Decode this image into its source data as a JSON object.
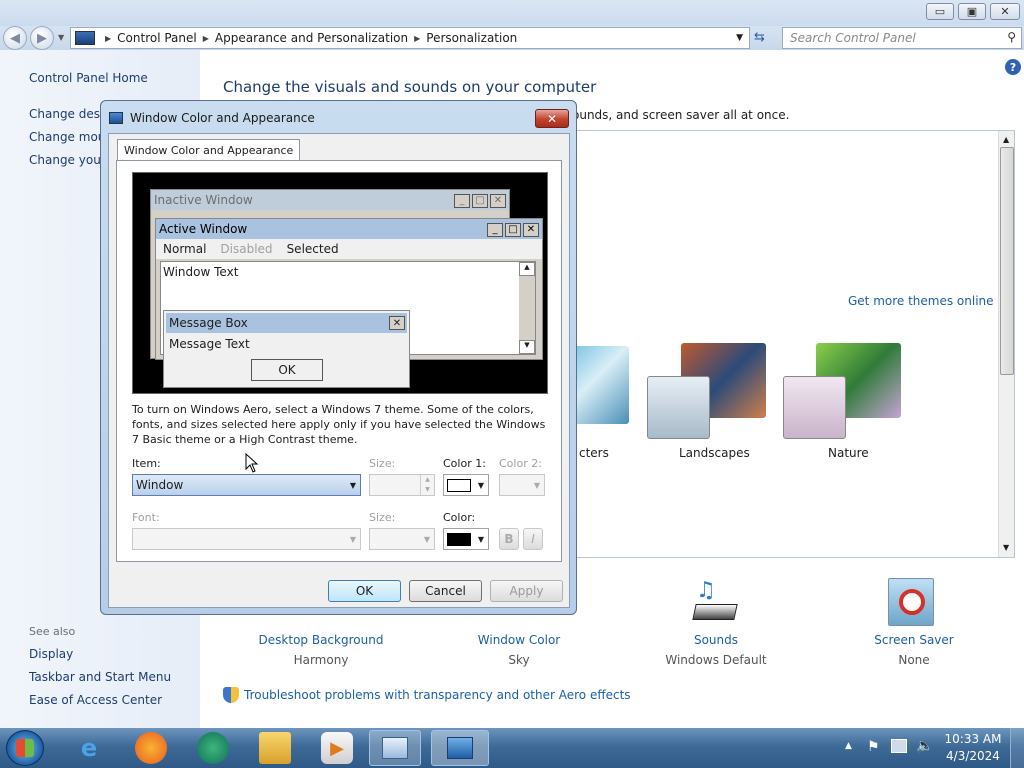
{
  "window": {
    "buttons": {
      "minimize": "▭",
      "maximize": "▣",
      "close": "✕"
    }
  },
  "address": {
    "crumbs": [
      "Control Panel",
      "Appearance and Personalization",
      "Personalization"
    ],
    "search_placeholder": "Search Control Panel"
  },
  "left_pane": {
    "home": "Control Panel Home",
    "links": [
      "Change desktop icons",
      "Change mouse pointers",
      "Change your account picture"
    ],
    "see_also_label": "See also",
    "see_also": [
      "Display",
      "Taskbar and Start Menu",
      "Ease of Access Center"
    ]
  },
  "main": {
    "title": "Change the visuals and sounds on your computer",
    "subtitle_tail": "ounds, and screen saver all at once.",
    "get_more": "Get more themes online",
    "themes": [
      "Characters",
      "Landscapes",
      "Nature"
    ],
    "themes_visible": [
      "cters",
      "Landscapes",
      "Nature"
    ],
    "bottom_items": [
      {
        "label": "Desktop Background",
        "value": "Harmony"
      },
      {
        "label": "Window Color",
        "value": "Sky"
      },
      {
        "label": "Sounds",
        "value": "Windows Default"
      },
      {
        "label": "Screen Saver",
        "value": "None"
      }
    ],
    "troubleshoot": "Troubleshoot problems with transparency and other Aero effects"
  },
  "dialog": {
    "title": "Window Color and Appearance",
    "tab": "Window Color and Appearance",
    "preview": {
      "inactive": "Inactive Window",
      "active": "Active Window",
      "menu": [
        "Normal",
        "Disabled",
        "Selected"
      ],
      "window_text": "Window Text",
      "msgbox_title": "Message Box",
      "msgbox_text": "Message Text",
      "msgbox_ok": "OK"
    },
    "info": "To turn on Windows Aero, select a Windows 7 theme.  Some of the colors, fonts, and sizes selected here apply only if you have selected the Windows 7 Basic theme or a High Contrast theme.",
    "item_label": "Item:",
    "item_value": "Window",
    "size_label": "Size:",
    "color1_label": "Color 1:",
    "color2_label": "Color 2:",
    "font_label": "Font:",
    "size2_label": "Size:",
    "color_label": "Color:",
    "bold": "B",
    "italic": "I",
    "ok": "OK",
    "cancel": "Cancel",
    "apply": "Apply",
    "color1_value": "#ffffff",
    "font_color_value": "#000000"
  },
  "taskbar": {
    "time": "10:33 AM",
    "date": "4/3/2024"
  }
}
